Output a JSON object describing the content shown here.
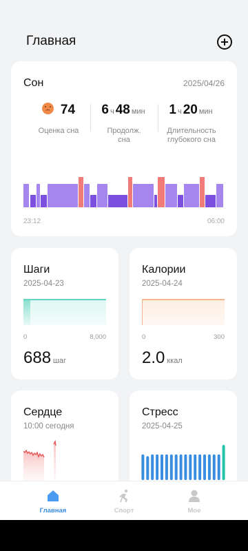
{
  "header": {
    "title": "Главная",
    "add_icon": "add-circle-icon"
  },
  "sleep": {
    "title": "Сон",
    "date": "2025/04/26",
    "score": {
      "icon": "sad-face-icon",
      "value": "74",
      "label": "Оценка сна"
    },
    "duration": {
      "hours": "6",
      "h_unit": "ч",
      "minutes": "48",
      "m_unit": "мин",
      "label": "Продолж. сна"
    },
    "deep": {
      "hours": "1",
      "h_unit": "ч",
      "minutes": "20",
      "m_unit": "мин",
      "label": "Длительность глубокого сна"
    },
    "start_time": "23:12",
    "end_time": "06:00",
    "stage_colors": {
      "light": "#a585ee",
      "deep": "#7c4fde",
      "awake": "#f07b78"
    }
  },
  "steps": {
    "title": "Шаги",
    "date": "2025-04-23",
    "axis_min": "0",
    "axis_max": "8,000",
    "value": "688",
    "unit": "шаг",
    "goal_fraction": 0.086,
    "color": "#5fd6c0"
  },
  "calories": {
    "title": "Калории",
    "date": "2025-04-24",
    "axis_min": "0",
    "axis_max": "300",
    "value": "2.0",
    "unit": "ккал",
    "color": "#f6b48c"
  },
  "heart": {
    "title": "Сердце",
    "date": "10:00 сегодня",
    "color": "#e65a5a"
  },
  "stress": {
    "title": "Стресс",
    "date": "2025-04-25",
    "bar_levels": [
      0.62,
      0.58,
      0.62,
      0.62,
      0.62,
      0.62,
      0.62,
      0.62,
      0.62,
      0.62,
      0.62,
      0.62,
      0.62,
      0.62,
      0.62,
      0.62,
      0.62,
      0.85
    ],
    "colors": {
      "normal": "#3a8de0",
      "last": "#22c3a8"
    }
  },
  "nav": {
    "items": [
      {
        "label": "Главная",
        "icon": "home-icon",
        "active": true
      },
      {
        "label": "Спорт",
        "icon": "running-icon",
        "active": false
      },
      {
        "label": "Мое",
        "icon": "profile-icon",
        "active": false
      }
    ]
  }
}
